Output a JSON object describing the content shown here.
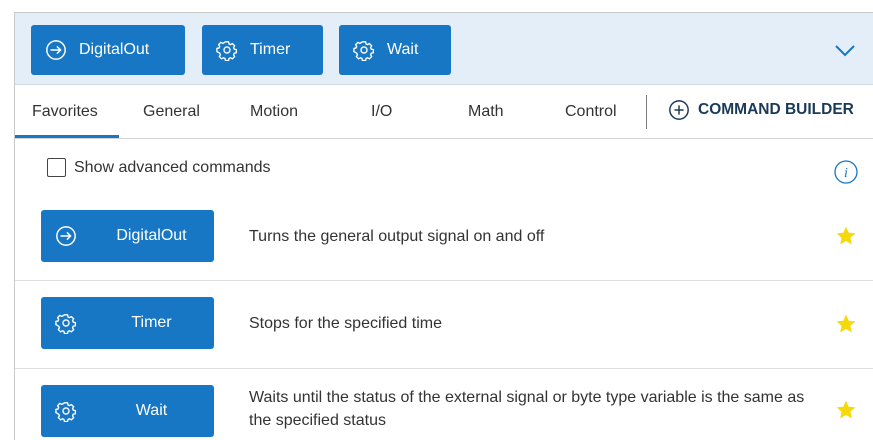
{
  "quickbar": {
    "buttons": [
      {
        "label": "DigitalOut",
        "icon": "arrow-circle-right-icon"
      },
      {
        "label": "Timer",
        "icon": "gear-icon"
      },
      {
        "label": "Wait",
        "icon": "gear-icon"
      }
    ],
    "expand_icon": "chevron-down-icon"
  },
  "tabs": {
    "items": [
      "Favorites",
      "General",
      "Motion",
      "I/O",
      "Math",
      "Control"
    ],
    "active": "Favorites",
    "builder_label": "COMMAND BUILDER"
  },
  "options": {
    "advanced_label": "Show advanced commands",
    "advanced_checked": false
  },
  "commands": [
    {
      "label": "DigitalOut",
      "icon": "arrow-circle-right-icon",
      "description": "Turns the general output signal on and off",
      "favorite": true
    },
    {
      "label": "Timer",
      "icon": "gear-icon",
      "description": "Stops for the specified time",
      "favorite": true
    },
    {
      "label": "Wait",
      "icon": "gear-icon",
      "description": "Waits until the status of the external signal or byte type variable is the same as the specified status",
      "favorite": true
    }
  ],
  "colors": {
    "accent": "#1777c4",
    "header_bg": "#e3eef8",
    "star": "#f5d90a"
  }
}
